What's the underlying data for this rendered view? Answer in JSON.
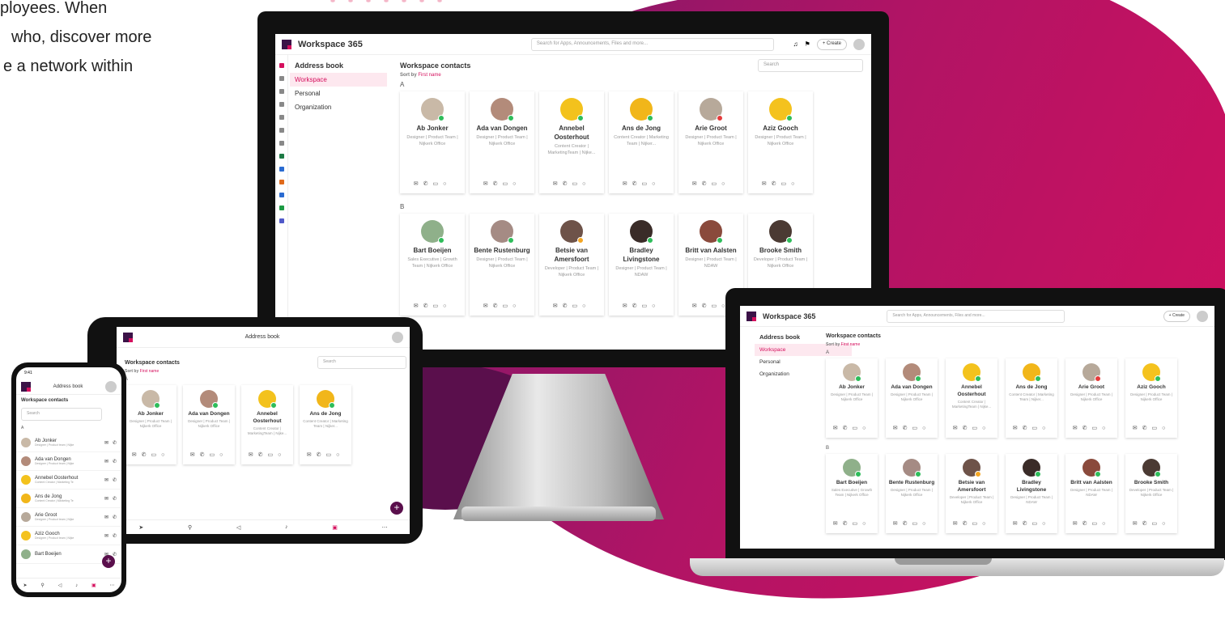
{
  "hero_text": [
    "ployees. When",
    "who, discover more",
    "e a network within"
  ],
  "app": {
    "title": "Workspace 365",
    "search_placeholder": "Search for Apps, Announcements, Files and more...",
    "create_label": "+ Create"
  },
  "sidebar": {
    "title": "Address book",
    "items": [
      {
        "label": "Workspace"
      },
      {
        "label": "Personal"
      },
      {
        "label": "Organization"
      }
    ]
  },
  "main": {
    "title": "Workspace contacts",
    "sort_prefix": "Sort by",
    "sort_value": "First name",
    "search_placeholder": "Search",
    "section_a": "A",
    "section_b": "B"
  },
  "contacts_a": [
    {
      "name": "Ab Jonker",
      "role": "Designer | Product Team | Nijkerk Office",
      "color": "#c9b9a7",
      "status": "#2ebd5a"
    },
    {
      "name": "Ada van Dongen",
      "role": "Designer | Product Team | Nijkerk Office",
      "color": "#b38b7a",
      "status": "#2ebd5a"
    },
    {
      "name": "Annebel Oosterhout",
      "role": "Content Creator | MarketingTeam | Nijke...",
      "color": "#f3c21d",
      "status": "#2ebd5a"
    },
    {
      "name": "Ans de Jong",
      "role": "Content Creator | Marketing Team | Nijker...",
      "color": "#f1b61a",
      "status": "#2ebd5a"
    },
    {
      "name": "Arie Groot",
      "role": "Designer | Product Team | Nijkerk Office",
      "color": "#b7a99a",
      "status": "#e53b3b"
    },
    {
      "name": "Aziz Gooch",
      "role": "Designer | Product Team | Nijkerk Office",
      "color": "#f4c21e",
      "status": "#2ebd5a"
    }
  ],
  "contacts_b": [
    {
      "name": "Bart Boeijen",
      "role": "Sales Executive | Growth Team | Nijkerk Office",
      "color": "#8fb08a",
      "status": "#2ebd5a"
    },
    {
      "name": "Bente Rustenburg",
      "role": "Designer | Product Team | Nijkerk Office",
      "color": "#a58b84",
      "status": "#2ebd5a"
    },
    {
      "name": "Betsie van Amersfoort",
      "role": "Developer | Product Team | Nijkerk Office",
      "color": "#6e5349",
      "status": "#f4a623"
    },
    {
      "name": "Bradley Livingstone",
      "role": "Designer | Product Team | NDAW",
      "color": "#3a2c28",
      "status": "#2ebd5a"
    },
    {
      "name": "Britt van Aalsten",
      "role": "Designer | Product Team | NDAW",
      "color": "#8a4a3c",
      "status": "#2ebd5a"
    },
    {
      "name": "Brooke Smith",
      "role": "Developer | Product Team | Nijkerk Office",
      "color": "#4b3a33",
      "status": "#2ebd5a"
    }
  ],
  "tablet": {
    "header": "Address book"
  },
  "phone": {
    "time": "9:41",
    "header": "Address book",
    "title": "Workspace contacts",
    "search_placeholder": "Search",
    "rows": [
      {
        "name": "Ab Jonker",
        "role": "Designer | Product team | Nijke",
        "color": "#c9b9a7"
      },
      {
        "name": "Ada van Dongen",
        "role": "Designer | Product team | Nijke",
        "color": "#b38b7a"
      },
      {
        "name": "Annebel Oosterhout",
        "role": "Content Creator | Marketing Te",
        "color": "#f3c21d"
      },
      {
        "name": "Ans de Jong",
        "role": "Content Creator | Marketing Te",
        "color": "#f1b61a"
      },
      {
        "name": "Arie Groot",
        "role": "Designer | Product team | Nijke",
        "color": "#b7a99a"
      },
      {
        "name": "Aziz Gooch",
        "role": "Designer | Product team | Nijke",
        "color": "#f4c21e"
      },
      {
        "name": "Bart Boeijen",
        "role": "",
        "color": "#8fb08a"
      }
    ]
  }
}
